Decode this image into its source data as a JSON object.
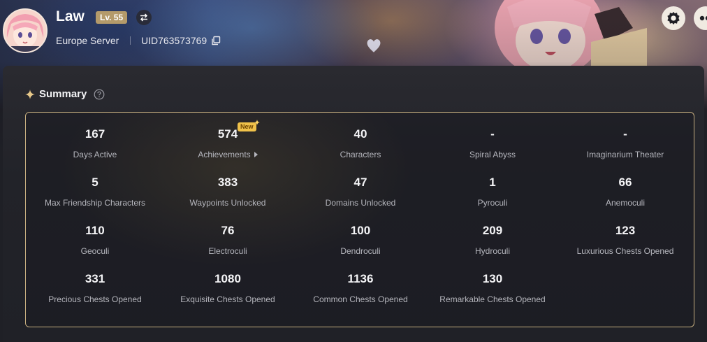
{
  "profile": {
    "name": "Law",
    "level": "Lv. 55",
    "server": "Europe Server",
    "uid": "UID763573769"
  },
  "icons": {
    "switch": "switch-arrows-icon",
    "copy": "copy-icon",
    "settings": "gear-icon",
    "more": "more-icon",
    "summary": "sparkle-icon",
    "help": "question-icon"
  },
  "summary": {
    "title": "Summary",
    "new_badge": "New",
    "stats": [
      {
        "value": "167",
        "label": "Days Active"
      },
      {
        "value": "574",
        "label": "Achievements"
      },
      {
        "value": "40",
        "label": "Characters"
      },
      {
        "value": "-",
        "label": "Spiral Abyss"
      },
      {
        "value": "-",
        "label": "Imaginarium Theater"
      },
      {
        "value": "5",
        "label": "Max Friendship Characters"
      },
      {
        "value": "383",
        "label": "Waypoints Unlocked"
      },
      {
        "value": "47",
        "label": "Domains Unlocked"
      },
      {
        "value": "1",
        "label": "Pyroculi"
      },
      {
        "value": "66",
        "label": "Anemoculi"
      },
      {
        "value": "110",
        "label": "Geoculi"
      },
      {
        "value": "76",
        "label": "Electroculi"
      },
      {
        "value": "100",
        "label": "Dendroculi"
      },
      {
        "value": "209",
        "label": "Hydroculi"
      },
      {
        "value": "123",
        "label": "Luxurious Chests Opened"
      },
      {
        "value": "331",
        "label": "Precious Chests Opened"
      },
      {
        "value": "1080",
        "label": "Exquisite Chests Opened"
      },
      {
        "value": "1136",
        "label": "Common Chests Opened"
      },
      {
        "value": "130",
        "label": "Remarkable Chests Opened"
      }
    ]
  },
  "colors": {
    "accent_gold": "#c5ad7f",
    "level_badge": "#b49a6a",
    "new_badge": "#f0c24a",
    "panel_bg": "#222329"
  }
}
